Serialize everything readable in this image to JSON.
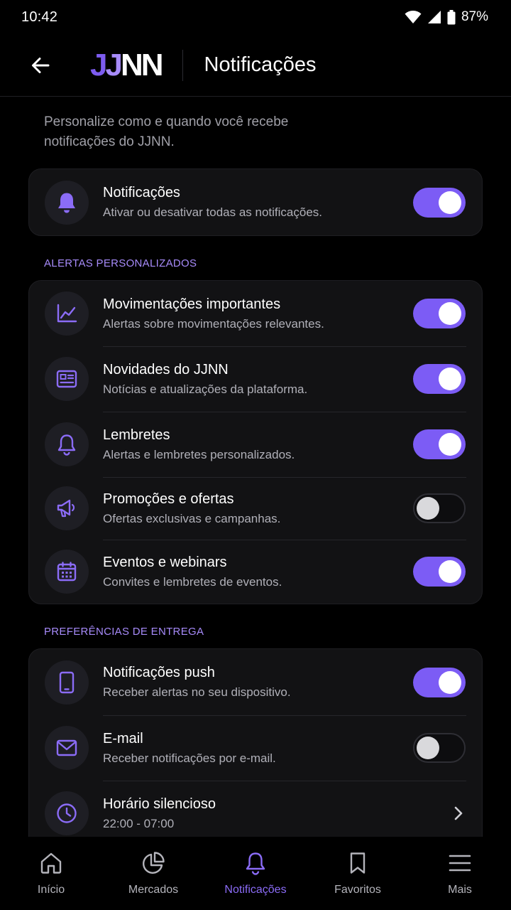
{
  "status_bar": {
    "time": "10:42",
    "battery": "87%"
  },
  "header": {
    "logo_j1": "J",
    "logo_j2": "J",
    "logo_nn": "NN",
    "title": "Notificações"
  },
  "intro": "Personalize como e quando você recebe notificações do JJNN.",
  "master": {
    "icon": "bell-icon",
    "title": "Notificações",
    "subtitle": "Ativar ou desativar todas as notificações.",
    "enabled": true
  },
  "sections": {
    "alerts_label": "ALERTAS PERSONALIZADOS",
    "delivery_label": "PREFERÊNCIAS DE ENTREGA"
  },
  "alerts": [
    {
      "icon": "trending-chart-icon",
      "title": "Movimentações importantes",
      "subtitle": "Alertas sobre movimentações relevantes.",
      "enabled": true
    },
    {
      "icon": "newspaper-icon",
      "title": "Novidades do JJNN",
      "subtitle": "Notícias e atualizações da plataforma.",
      "enabled": true
    },
    {
      "icon": "bell-outline-icon",
      "title": "Lembretes",
      "subtitle": "Alertas e lembretes personalizados.",
      "enabled": true
    },
    {
      "icon": "megaphone-icon",
      "title": "Promoções e ofertas",
      "subtitle": "Ofertas exclusivas e campanhas.",
      "enabled": false
    },
    {
      "icon": "calendar-icon",
      "title": "Eventos e webinars",
      "subtitle": "Convites e lembretes de eventos.",
      "enabled": true
    }
  ],
  "delivery": [
    {
      "icon": "smartphone-icon",
      "title": "Notificações push",
      "subtitle": "Receber alertas no seu dispositivo.",
      "enabled": true
    },
    {
      "icon": "mail-icon",
      "title": "E-mail",
      "subtitle": "Receber notificações por e-mail.",
      "enabled": false
    },
    {
      "icon": "clock-icon",
      "title": "Horário silencioso",
      "subtitle": "22:00 - 07:00"
    }
  ],
  "nav": [
    {
      "icon": "home-icon",
      "label": "Início",
      "active": false
    },
    {
      "icon": "pie-chart-icon",
      "label": "Mercados",
      "active": false
    },
    {
      "icon": "bell-icon",
      "label": "Notificações",
      "active": true
    },
    {
      "icon": "bookmark-icon",
      "label": "Favoritos",
      "active": false
    },
    {
      "icon": "menu-icon",
      "label": "Mais",
      "active": false
    }
  ],
  "colors": {
    "accent": "#7c5cf5",
    "accent_light": "#a78bfa",
    "background": "#000000",
    "card": "#121214"
  }
}
